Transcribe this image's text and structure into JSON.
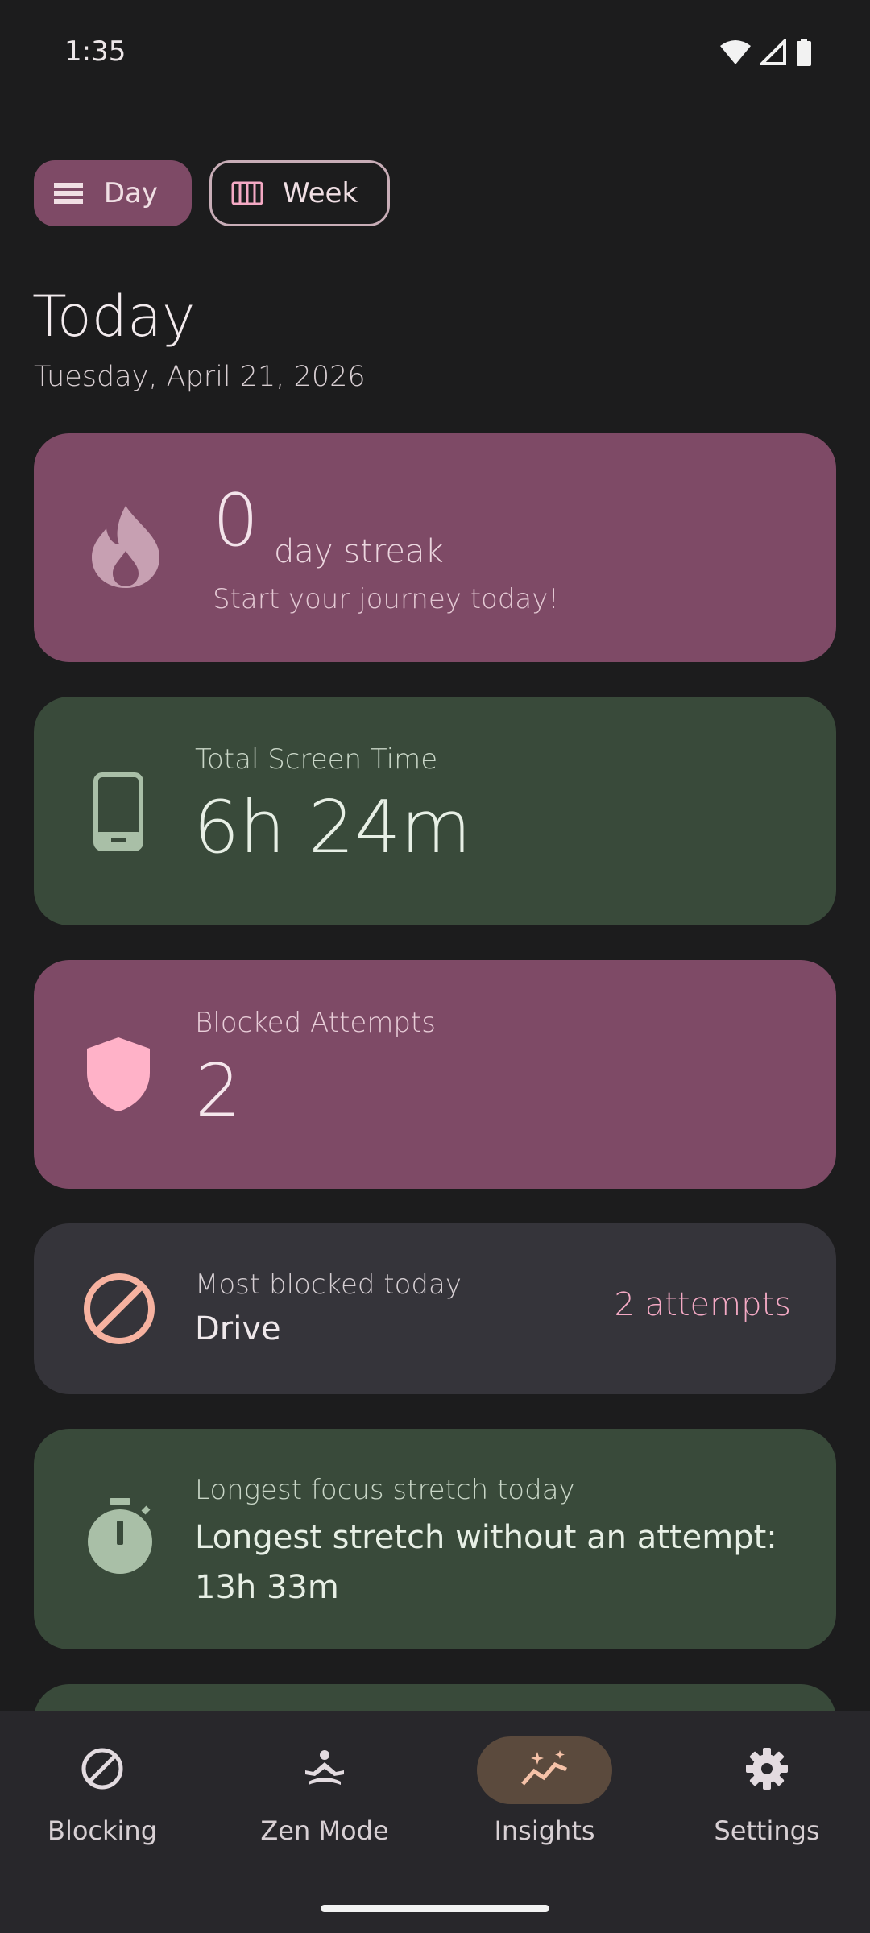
{
  "status": {
    "time": "1:35"
  },
  "toggle": {
    "day_label": "Day",
    "week_label": "Week"
  },
  "header": {
    "title": "Today",
    "date": "Tuesday, April 21, 2026"
  },
  "streak": {
    "count": "0",
    "label": "day streak",
    "subtitle": "Start your journey today!"
  },
  "screen_time": {
    "label": "Total Screen Time",
    "value": "6h 24m"
  },
  "blocked": {
    "label": "Blocked Attempts",
    "value": "2"
  },
  "most_blocked": {
    "label": "Most blocked today",
    "app": "Drive",
    "attempts": "2 attempts"
  },
  "focus": {
    "label": "Longest focus stretch today",
    "value": "Longest stretch without an attempt: 13h 33m"
  },
  "nav": {
    "items": [
      {
        "label": "Blocking",
        "icon": "block-icon"
      },
      {
        "label": "Zen Mode",
        "icon": "meditation-icon"
      },
      {
        "label": "Insights",
        "icon": "insights-icon",
        "active": true
      },
      {
        "label": "Settings",
        "icon": "gear-icon"
      }
    ]
  },
  "colors": {
    "background": "#1c1c1d",
    "pink_card": "#7e4a66",
    "green_card": "#394a3a",
    "gray_card": "#35343a",
    "accent_pink": "#f4a9c4",
    "nav_active": "#5b4a3d"
  }
}
